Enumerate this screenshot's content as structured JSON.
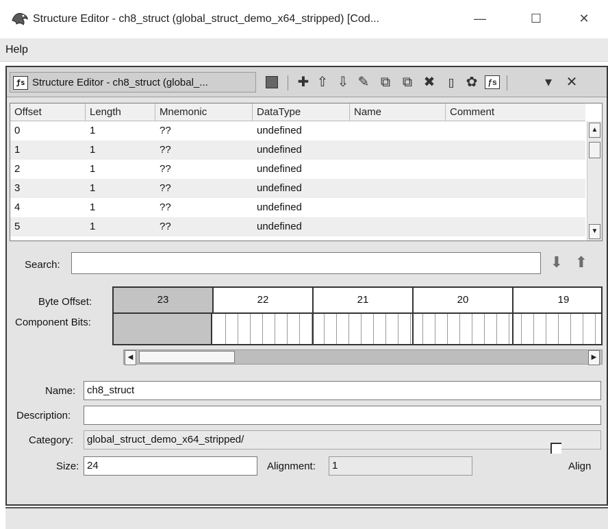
{
  "window": {
    "title": "Structure Editor - ch8_struct (global_struct_demo_x64_stripped) [Cod...",
    "min_glyph": "—",
    "max_glyph": "☐",
    "close_glyph": "✕"
  },
  "menu": {
    "items": [
      "Help"
    ]
  },
  "panel": {
    "tab_icon_text": "ƒs",
    "tab_title": "Structure Editor - ch8_struct (global_...",
    "toolbar": [
      {
        "name": "apply-icon",
        "glyph": ""
      },
      {
        "name": "insert-icon",
        "glyph": "✚"
      },
      {
        "name": "move-up-icon",
        "glyph": "⇧"
      },
      {
        "name": "move-down-icon",
        "glyph": "⇩"
      },
      {
        "name": "edit-icon",
        "glyph": "✎"
      },
      {
        "name": "duplicate-icon",
        "glyph": "⧉"
      },
      {
        "name": "duplicate-multiple-icon",
        "glyph": "⧉"
      },
      {
        "name": "delete-icon",
        "glyph": "✖"
      },
      {
        "name": "array-icon",
        "glyph": "[]"
      },
      {
        "name": "unpackage-icon",
        "glyph": "✿"
      },
      {
        "name": "show-component-icon",
        "glyph": "ƒs"
      },
      {
        "name": "menu-dropdown-icon",
        "glyph": "▾"
      },
      {
        "name": "close-panel-icon",
        "glyph": "✕"
      }
    ]
  },
  "table": {
    "columns": [
      "Offset",
      "Length",
      "Mnemonic",
      "DataType",
      "Name",
      "Comment"
    ],
    "rows": [
      [
        "0",
        "1",
        "??",
        "undefined",
        "",
        ""
      ],
      [
        "1",
        "1",
        "??",
        "undefined",
        "",
        ""
      ],
      [
        "2",
        "1",
        "??",
        "undefined",
        "",
        ""
      ],
      [
        "3",
        "1",
        "??",
        "undefined",
        "",
        ""
      ],
      [
        "4",
        "1",
        "??",
        "undefined",
        "",
        ""
      ],
      [
        "5",
        "1",
        "??",
        "undefined",
        "",
        ""
      ]
    ]
  },
  "search": {
    "label": "Search:",
    "value": ""
  },
  "bits": {
    "byte_offset_label": "Byte Offset:",
    "component_bits_label": "Component Bits:",
    "byte_offsets": [
      "23",
      "22",
      "21",
      "20",
      "19"
    ]
  },
  "form": {
    "name_label": "Name:",
    "name_value": "ch8_struct",
    "description_label": "Description:",
    "description_value": "",
    "category_label": "Category:",
    "category_value": "global_struct_demo_x64_stripped/",
    "size_label": "Size:",
    "size_value": "24",
    "alignment_label": "Alignment:",
    "alignment_value": "1",
    "align_label": "Align",
    "align_checked": false
  }
}
